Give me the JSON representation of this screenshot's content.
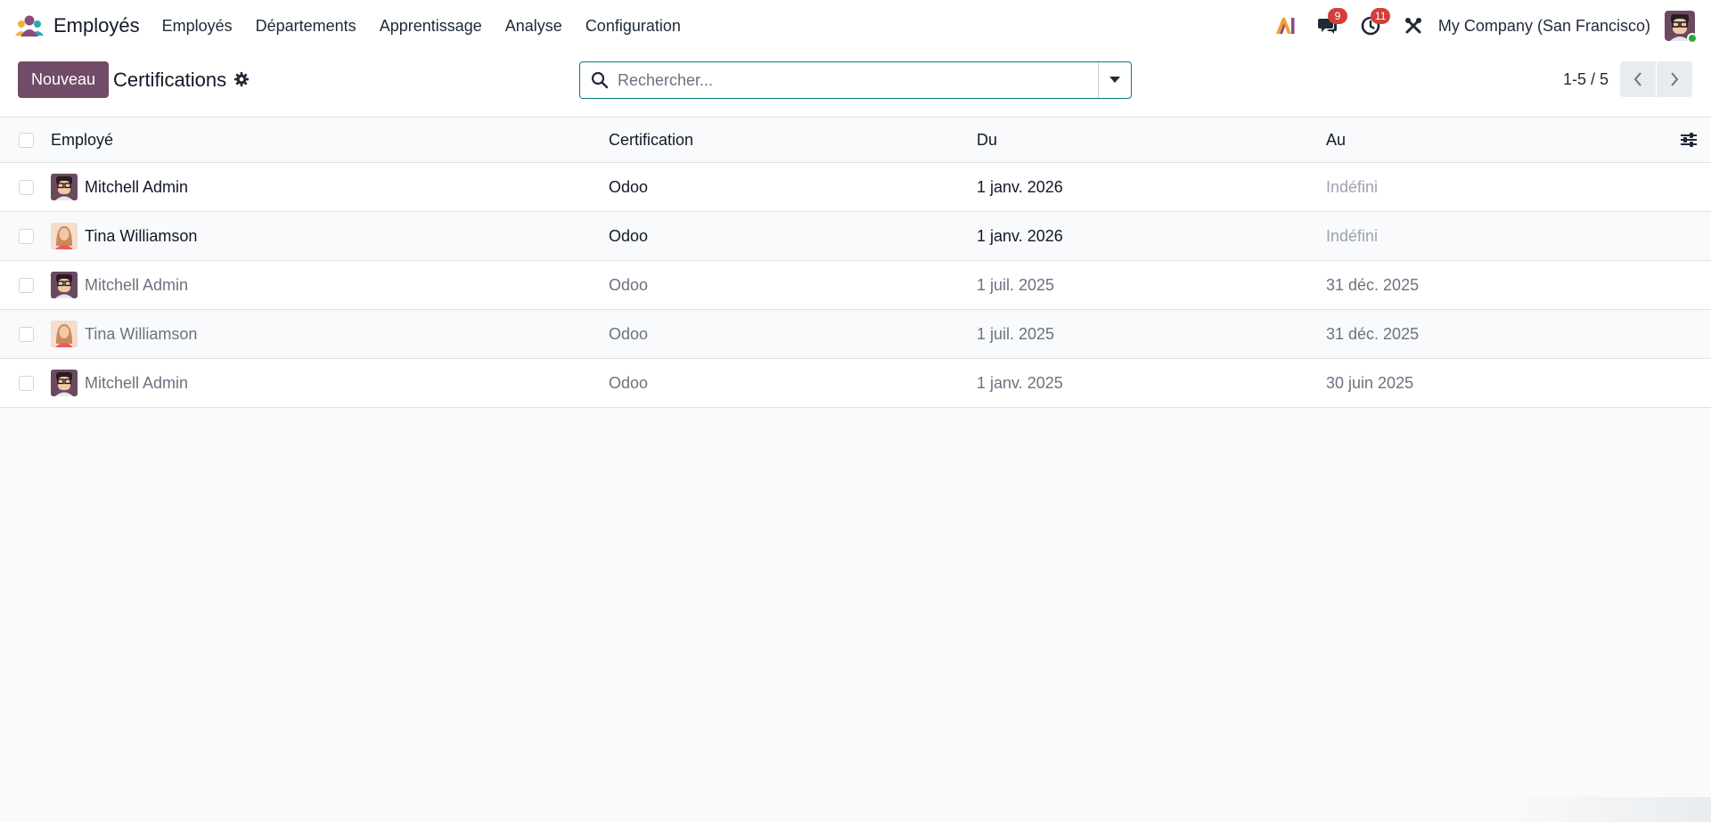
{
  "app": {
    "name": "Employés"
  },
  "menu": [
    "Employés",
    "Départements",
    "Apprentissage",
    "Analyse",
    "Configuration"
  ],
  "navbar": {
    "messages_count": "9",
    "activities_count": "11",
    "company": "My Company (San Francisco)"
  },
  "control": {
    "new_label": "Nouveau",
    "title": "Certifications",
    "search_placeholder": "Rechercher...",
    "pager": "1-5 / 5"
  },
  "table": {
    "headers": {
      "employee": "Employé",
      "certification": "Certification",
      "from": "Du",
      "to": "Au"
    },
    "rows": [
      {
        "employee": "Mitchell Admin",
        "certification": "Odoo",
        "from": "1 janv. 2026",
        "to": "Indéfini",
        "avatar": "man"
      },
      {
        "employee": "Tina Williamson",
        "certification": "Odoo",
        "from": "1 janv. 2026",
        "to": "Indéfini",
        "avatar": "woman"
      },
      {
        "employee": "Mitchell Admin",
        "certification": "Odoo",
        "from": "1 juil. 2025",
        "to": "31 déc. 2025",
        "avatar": "man"
      },
      {
        "employee": "Tina Williamson",
        "certification": "Odoo",
        "from": "1 juil. 2025",
        "to": "31 déc. 2025",
        "avatar": "woman"
      },
      {
        "employee": "Mitchell Admin",
        "certification": "Odoo",
        "from": "1 janv. 2025",
        "to": "30 juin 2025",
        "avatar": "man"
      }
    ]
  },
  "colors": {
    "primary": "#714b67",
    "accent": "#017e84",
    "badge": "#d23f3a"
  }
}
